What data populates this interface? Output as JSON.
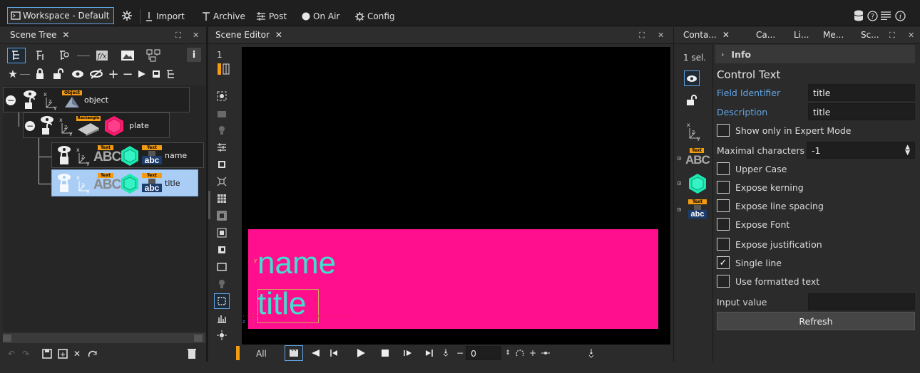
{
  "toolbar": {
    "workspace": "Workspace - Default",
    "import": "Import",
    "archive": "Archive",
    "post": "Post",
    "on_air": "On Air",
    "config": "Config"
  },
  "scene_tree": {
    "tab": "Scene Tree",
    "nodes": {
      "object": {
        "label": "object",
        "tag": "Object"
      },
      "plate": {
        "label": "plate",
        "tag": "Rectangle"
      },
      "name": {
        "label": "name",
        "tag1": "Text",
        "tag2": "Text",
        "glyph": "ABC",
        "glyph2": "abc"
      },
      "title": {
        "label": "title",
        "tag1": "Text",
        "tag2": "Text",
        "glyph": "ABC",
        "glyph2": "abc"
      }
    }
  },
  "scene_editor": {
    "tab": "Scene Editor",
    "layer_number": "1",
    "canvas_text_name": "name",
    "canvas_text_title": "title",
    "bottom": {
      "all": "All",
      "frame_value": "0"
    }
  },
  "right_panel": {
    "tabs": [
      "Conta...",
      "Ca...",
      "Li...",
      "Me...",
      "Sc..."
    ],
    "selection": "1 sel.",
    "info_label": "Info",
    "section_title": "Control Text",
    "field_identifier_label": "Field Identifier",
    "field_identifier_value": "title",
    "description_label": "Description",
    "description_value": "title",
    "expert_mode": "Show only in Expert Mode",
    "maximal_characters_label": "Maximal characters",
    "maximal_characters_value": "-1",
    "upper_case": "Upper Case",
    "expose_kerning": "Expose kerning",
    "expose_line_spacing": "Expose line spacing",
    "expose_font": "Expose Font",
    "expose_justification": "Expose justification",
    "single_line": "Single line",
    "use_formatted_text": "Use formatted text",
    "input_value_label": "Input value",
    "input_value": "",
    "refresh": "Refresh",
    "tag_text": "Text",
    "glyph": "ABC",
    "glyph2": "abc"
  },
  "colors": {
    "accent": "#5fa3e3",
    "plate": "#ff0f8e",
    "text": "#40e0d0",
    "selected_row": "#a9cdf5"
  }
}
